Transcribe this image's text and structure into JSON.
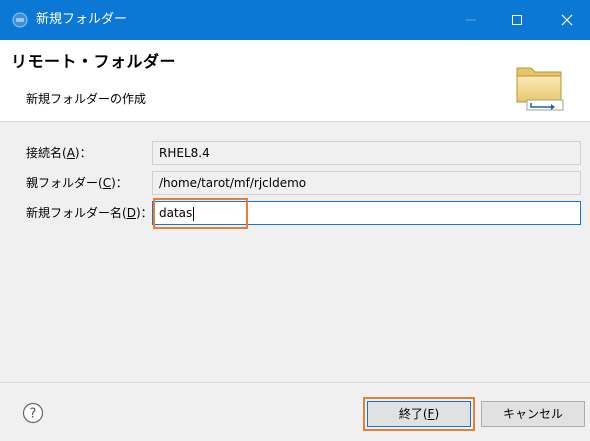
{
  "window": {
    "title": "新規フォルダー",
    "minimize_glyph": "—",
    "maximize_glyph": "☐",
    "close_glyph": "✕"
  },
  "header": {
    "title": "リモート・フォルダー",
    "description": "新規フォルダーの作成"
  },
  "form": {
    "connection": {
      "label": "接続名",
      "mnemonic": "A",
      "suffix": "：",
      "value": "RHEL8.4"
    },
    "parent": {
      "label": "親フォルダー",
      "mnemonic": "C",
      "suffix": "：",
      "value": "/home/tarot/mf/rjcldemo"
    },
    "new_name": {
      "label": "新規フォルダー名",
      "mnemonic": "D",
      "suffix": "：",
      "value": "datas"
    }
  },
  "footer": {
    "help_glyph": "?",
    "finish": {
      "label": "終了",
      "mnemonic": "F"
    },
    "cancel": {
      "label": "キャンセル"
    }
  },
  "colors": {
    "titlebar": "#0a78d4",
    "highlight": "#ed7d31",
    "focus_border": "#0a78d4"
  }
}
